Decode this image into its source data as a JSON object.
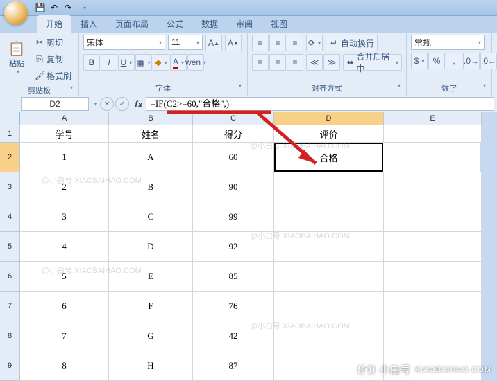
{
  "qat": {
    "save": "💾",
    "undo": "↶",
    "redo": "↷"
  },
  "tabs": [
    "开始",
    "插入",
    "页面布局",
    "公式",
    "数据",
    "审阅",
    "视图"
  ],
  "clipboard": {
    "paste": "粘贴",
    "cut": "剪切",
    "copy": "复制",
    "fmt": "格式刷",
    "label": "剪贴板"
  },
  "font": {
    "name": "宋体",
    "size": "11",
    "label": "字体"
  },
  "align": {
    "wrap": "自动换行",
    "merge": "合并后居中",
    "label": "对齐方式"
  },
  "number": {
    "fmt": "常规",
    "label": "数字"
  },
  "namebox": "D2",
  "formula": "=IF(C2>=60,\"合格\",)",
  "cols": [
    "A",
    "B",
    "C",
    "D",
    "E"
  ],
  "rows": [
    "1",
    "2",
    "3",
    "4",
    "5",
    "6",
    "7",
    "8",
    "9"
  ],
  "chart_data": {
    "type": "table",
    "columns": [
      "学号",
      "姓名",
      "得分",
      "评价"
    ],
    "data": [
      [
        "1",
        "A",
        "60",
        "合格"
      ],
      [
        "2",
        "B",
        "90",
        ""
      ],
      [
        "3",
        "C",
        "99",
        ""
      ],
      [
        "4",
        "D",
        "92",
        ""
      ],
      [
        "5",
        "E",
        "85",
        ""
      ],
      [
        "6",
        "F",
        "76",
        ""
      ],
      [
        "7",
        "G",
        "42",
        ""
      ],
      [
        "8",
        "H",
        "87",
        ""
      ]
    ]
  },
  "brand": {
    "name": "小白号",
    "domain": "XIAOBAIHAO.COM",
    "wm": "@小白号 XIAOBAIHAO.COM"
  }
}
